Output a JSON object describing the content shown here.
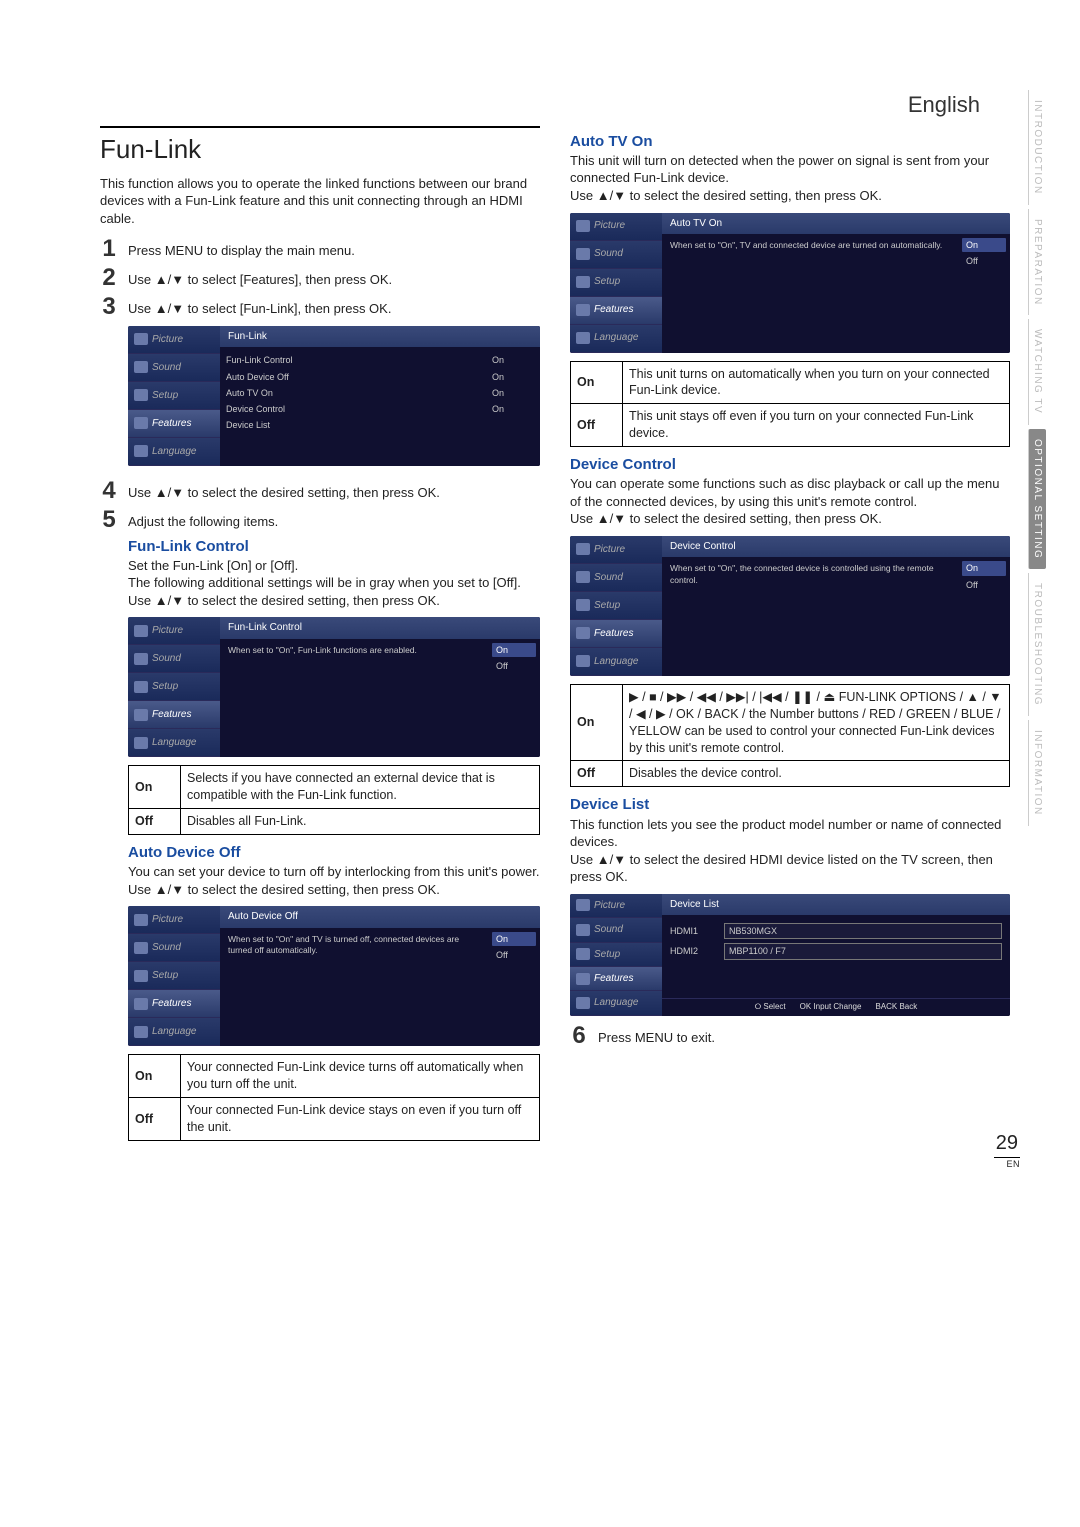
{
  "language_label": "English",
  "page_number": "29",
  "page_locale": "EN",
  "side_tabs": [
    "INTRODUCTION",
    "PREPARATION",
    "WATCHING TV",
    "OPTIONAL SETTING",
    "TROUBLESHOOTING",
    "INFORMATION"
  ],
  "side_tab_active_index": 3,
  "sidebar_items": [
    "Picture",
    "Sound",
    "Setup",
    "Features",
    "Language"
  ],
  "left": {
    "title": "Fun-Link",
    "intro": "This function allows you to operate the linked functions between our brand devices with a Fun-Link feature and this unit connecting through an HDMI cable.",
    "step1": "Press MENU to display the main menu.",
    "step2": "Use ▲/▼ to select [Features], then press OK.",
    "step3": "Use ▲/▼ to select [Fun-Link], then press OK.",
    "ss_funlink_title": "Fun-Link",
    "ss_funlink_rows": [
      "Fun-Link Control",
      "Auto Device Off",
      "Auto TV On",
      "Device Control",
      "Device List"
    ],
    "ss_funlink_vals": [
      "On",
      "On",
      "On",
      "On",
      ""
    ],
    "step4": "Use ▲/▼ to select the desired setting, then press OK.",
    "step5": "Adjust the following items.",
    "flc_heading": "Fun-Link Control",
    "flc_line1": "Set the Fun-Link [On] or [Off].",
    "flc_line2": "The following additional settings will be in gray when you set to [Off].",
    "flc_line3": "Use ▲/▼ to select the desired setting, then press OK.",
    "ss_flc_title": "Fun-Link Control",
    "ss_flc_hint": "When set to \"On\", Fun-Link functions are enabled.",
    "choice_on": "On",
    "choice_off": "Off",
    "flc_table_on": "Selects if you have connected an external device that is compatible with the Fun-Link function.",
    "flc_table_off": "Disables all Fun-Link.",
    "ado_heading": "Auto Device Off",
    "ado_line1": "You can set your device to turn off by interlocking from this unit's power.",
    "ado_line2": "Use ▲/▼ to select the desired setting, then press OK.",
    "ss_ado_title": "Auto Device Off",
    "ss_ado_hint": "When set to \"On\" and TV is turned off, connected devices are turned off automatically.",
    "ado_table_on": "Your connected Fun-Link device turns off automatically when you turn off the unit.",
    "ado_table_off": "Your connected Fun-Link device stays on even if you turn off the unit."
  },
  "right": {
    "atv_heading": "Auto TV On",
    "atv_line1": "This unit will turn on detected when the power on signal is sent from your connected Fun-Link device.",
    "atv_line2": "Use ▲/▼ to select the desired setting, then press OK.",
    "ss_atv_title": "Auto TV On",
    "ss_atv_hint": "When set to \"On\", TV and connected device are turned on automatically.",
    "atv_table_on": "This unit turns on automatically when you turn on your connected Fun-Link device.",
    "atv_table_off": "This unit stays off even if you turn on your connected Fun-Link device.",
    "dc_heading": "Device Control",
    "dc_line1": "You can operate some functions such as disc playback or call up the menu of the connected devices, by using this unit's remote control.",
    "dc_line2": "Use ▲/▼ to select the desired setting, then press OK.",
    "ss_dc_title": "Device Control",
    "ss_dc_hint": "When set to \"On\", the connected device is controlled using the remote control.",
    "dc_table_on": "▶ / ■ / ▶▶ / ◀◀ / ▶▶| / |◀◀ / ❚❚ / ⏏ FUN-LINK OPTIONS / ▲ / ▼ / ◀ / ▶ / OK / BACK / the Number buttons / RED / GREEN / BLUE / YELLOW can be used to control your connected Fun-Link devices by this unit's remote control.",
    "dc_table_off": "Disables the device control.",
    "dl_heading": "Device List",
    "dl_line1": "This function lets you see the product model number or name of connected devices.",
    "dl_line2": "Use ▲/▼ to select the desired HDMI device listed on the TV screen, then press OK.",
    "ss_dl_title": "Device List",
    "dl_hdmi1_port": "HDMI1",
    "dl_hdmi1_name": "NB530MGX",
    "dl_hdmi2_port": "HDMI2",
    "dl_hdmi2_name": "MBP1100 / F7",
    "dl_footer_select": "Select",
    "dl_footer_input": "Input Change",
    "dl_footer_back": "Back",
    "step6": "Press MENU to exit."
  },
  "k_on": "On",
  "k_off": "Off"
}
